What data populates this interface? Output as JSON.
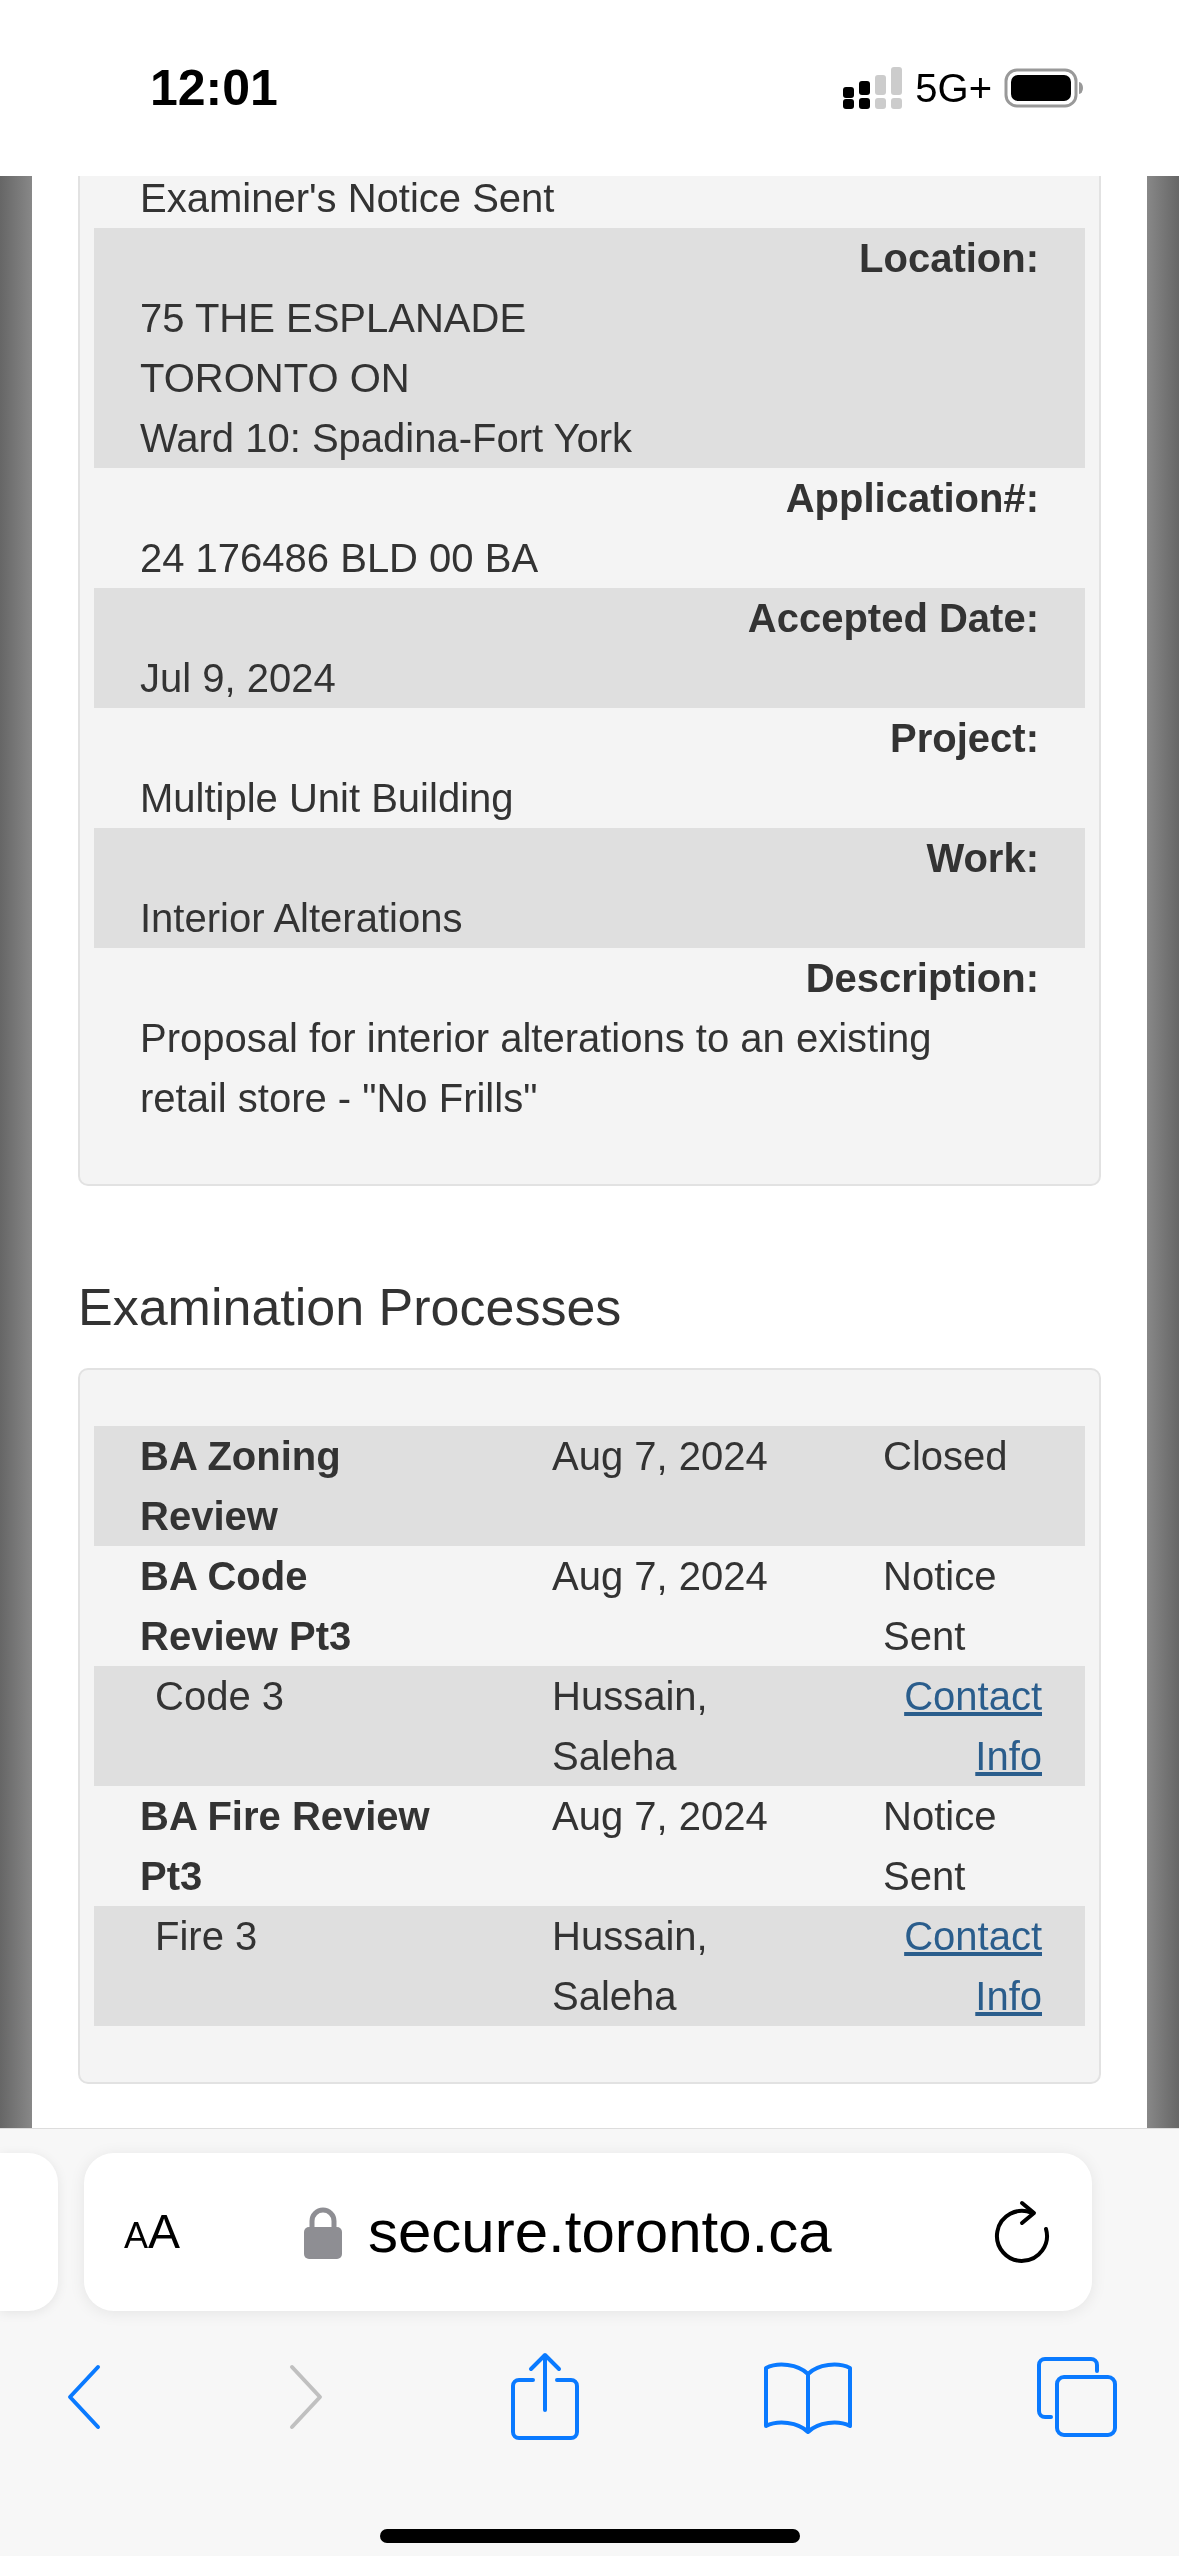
{
  "status_bar": {
    "time": "12:01",
    "network": "5G+"
  },
  "details": [
    {
      "value_lines": [
        "Examiner's Notice Sent"
      ]
    },
    {
      "label": "Location:",
      "value_lines": [
        "75 THE ESPLANADE",
        "TORONTO ON",
        "Ward 10: Spadina-Fort York"
      ]
    },
    {
      "label": "Application#:",
      "value_lines": [
        "24 176486 BLD 00 BA"
      ]
    },
    {
      "label": "Accepted Date:",
      "value_lines": [
        "Jul 9, 2024"
      ]
    },
    {
      "label": "Project:",
      "value_lines": [
        "Multiple Unit Building"
      ]
    },
    {
      "label": "Work:",
      "value_lines": [
        "Interior Alterations"
      ]
    },
    {
      "label": "Description:",
      "value_lines": [
        "Proposal for interior alterations to an existing",
        "retail store - \"No Frills\""
      ]
    }
  ],
  "examination": {
    "heading": "Examination Processes",
    "rows": [
      {
        "kind": "process",
        "name_lines": [
          "BA Zoning",
          "Review"
        ],
        "date": "Aug 7, 2024",
        "status_lines": [
          "Closed"
        ]
      },
      {
        "kind": "process",
        "name_lines": [
          "BA Code",
          "Review Pt3"
        ],
        "date": "Aug 7, 2024",
        "status_lines": [
          "Notice",
          "Sent"
        ]
      },
      {
        "kind": "reviewer",
        "name": "Code 3",
        "reviewer_lines": [
          "Hussain,",
          "Saleha"
        ],
        "link_lines": [
          "Contact",
          "Info"
        ]
      },
      {
        "kind": "process",
        "name_lines": [
          "BA Fire Review",
          "Pt3"
        ],
        "date": "Aug 7, 2024",
        "status_lines": [
          "Notice",
          "Sent"
        ]
      },
      {
        "kind": "reviewer",
        "name": "Fire 3",
        "reviewer_lines": [
          "Hussain,",
          "Saleha"
        ],
        "link_lines": [
          "Contact",
          "Info"
        ]
      }
    ]
  },
  "browser": {
    "text_size": "AA",
    "url": "secure.toronto.ca",
    "toolbar": [
      {
        "kind": "back",
        "disabled": false
      },
      {
        "kind": "forward",
        "disabled": true
      },
      {
        "kind": "share",
        "disabled": false
      },
      {
        "kind": "bookmarks",
        "disabled": false
      },
      {
        "kind": "tabs",
        "disabled": false
      }
    ]
  }
}
